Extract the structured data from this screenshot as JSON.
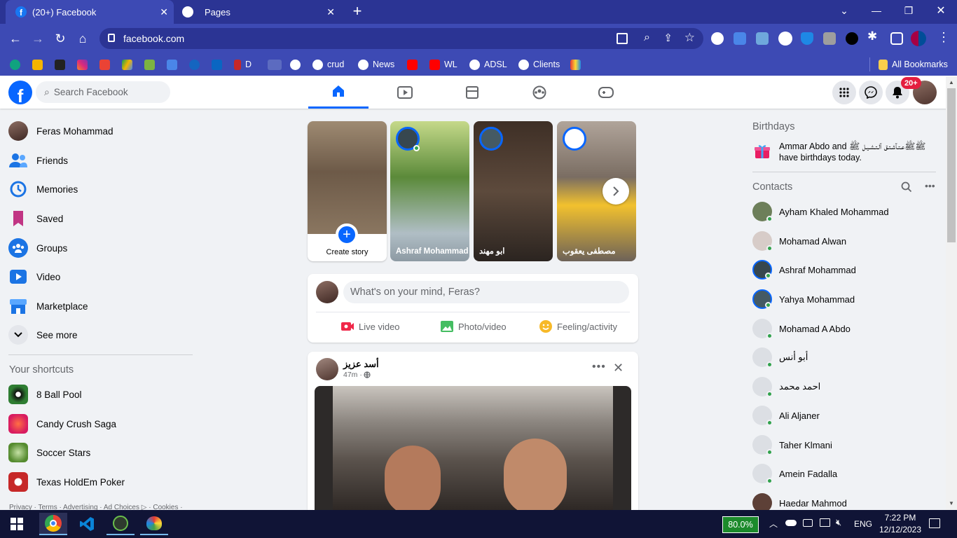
{
  "browser": {
    "tabs": [
      {
        "title": "(20+) Facebook",
        "active": true
      },
      {
        "title": "Pages",
        "active": false
      }
    ],
    "new_tab_symbol": "+",
    "url": "facebook.com",
    "bookmarks": [
      "D",
      "crud",
      "News",
      "WL",
      "ADSL",
      "Clients"
    ],
    "all_bookmarks": "All Bookmarks"
  },
  "fb": {
    "search_placeholder": "Search Facebook",
    "notif_badge": "20+",
    "left_nav": [
      {
        "label": "Feras Mohammad",
        "icon": "profile-avatar"
      },
      {
        "label": "Friends",
        "icon": "friends-icon"
      },
      {
        "label": "Memories",
        "icon": "memories-icon"
      },
      {
        "label": "Saved",
        "icon": "saved-icon"
      },
      {
        "label": "Groups",
        "icon": "groups-icon"
      },
      {
        "label": "Video",
        "icon": "video-icon"
      },
      {
        "label": "Marketplace",
        "icon": "marketplace-icon"
      },
      {
        "label": "See more",
        "icon": "chevron-down-icon"
      }
    ],
    "shortcuts_title": "Your shortcuts",
    "shortcuts": [
      "8 Ball Pool",
      "Candy Crush Saga",
      "Soccer Stars",
      "Texas HoldEm Poker"
    ],
    "footer": "Privacy · Terms · Advertising · Ad Choices ▷ · Cookies ·",
    "stories": [
      {
        "name": "Create story"
      },
      {
        "name": "Ashraf Mohammad"
      },
      {
        "name": "ابو مهند"
      },
      {
        "name": "مصطفى يعقوب"
      }
    ],
    "composer": {
      "placeholder": "What's on your mind, Feras?",
      "live": "Live video",
      "photo": "Photo/video",
      "feeling": "Feeling/activity"
    },
    "post": {
      "author": "أسد عزيز",
      "time": "47m · "
    },
    "birthdays": {
      "title": "Birthdays",
      "text": "Ammar Abdo and ﷺﷺعـتـآشـتـق آلـتـشـيـل ﷺ have birthdays today."
    },
    "contacts_title": "Contacts",
    "contacts": [
      "Ayham Khaled Mohammad",
      "Mohamad Alwan",
      "Ashraf Mohammad",
      "Yahya Mohammad",
      "Mohamad A Abdo",
      "أبو أنس",
      "احمد محمد",
      "Ali Aljaner",
      "Taher Klmani",
      "Amein Fadalla",
      "Haedar Mahmod"
    ]
  },
  "taskbar": {
    "battery": "80.0%",
    "lang": "ENG",
    "time": "7:22 PM",
    "date": "12/12/2023"
  }
}
